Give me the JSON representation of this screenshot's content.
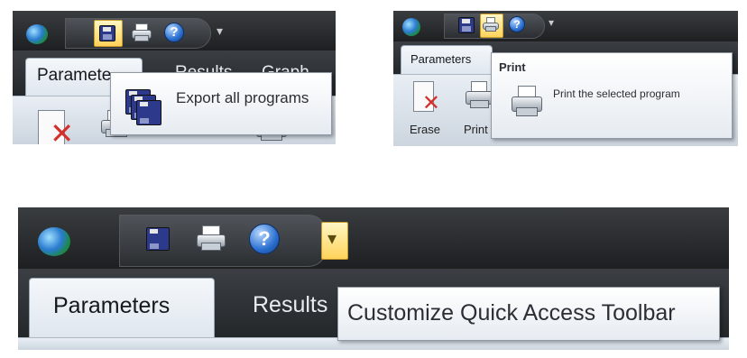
{
  "panel1": {
    "tab_parameters": "Paramete",
    "tab_results_partial": "Results",
    "tab_third_partial": "Graph",
    "tooltip_text": "Export all programs",
    "icons": [
      "orb-icon",
      "floppy-stack-icon",
      "printer-icon",
      "help-icon",
      "qat-dropdown-icon"
    ]
  },
  "panel2": {
    "tab_parameters": "Parameters",
    "erase_label": "Erase",
    "print_label": "Print",
    "tooltip_title": "Print",
    "tooltip_text": "Print the selected program"
  },
  "panel3": {
    "tab_parameters": "Parameters",
    "tab_results": "Results",
    "tooltip_text": "Customize Quick Access Toolbar",
    "dropdown_glyph": "▾"
  },
  "colors": {
    "titlebar": "#2b2e31",
    "tab_active": "#eef2f6",
    "tooltip_bg": "#ffffff",
    "highlight": "#ffd35a"
  }
}
